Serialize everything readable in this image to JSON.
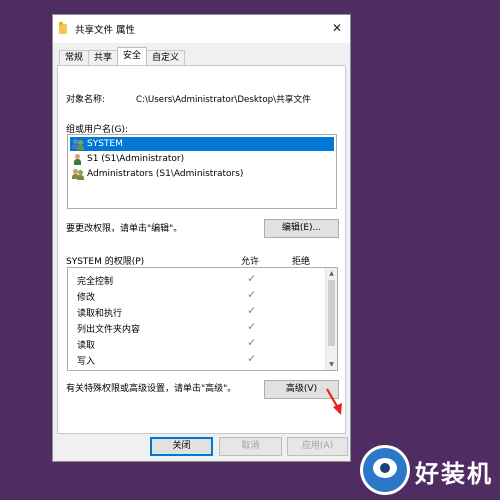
{
  "window": {
    "title": "共享文件 属性"
  },
  "tabs": [
    {
      "label": "常规"
    },
    {
      "label": "共享"
    },
    {
      "label": "安全"
    },
    {
      "label": "自定义"
    }
  ],
  "security": {
    "object_label": "对象名称:",
    "object_value": "C:\\Users\\Administrator\\Desktop\\共享文件",
    "group_label": "组或用户名(G):",
    "users": [
      {
        "name": "SYSTEM"
      },
      {
        "name": "S1 (S1\\Administrator)"
      },
      {
        "name": "Administrators (S1\\Administrators)"
      }
    ],
    "change_text": "要更改权限，请单击\"编辑\"。",
    "edit_button": "编辑(E)...",
    "perm_label": "SYSTEM 的权限(P)",
    "allow_header": "允许",
    "deny_header": "拒绝",
    "permissions": [
      {
        "name": "完全控制",
        "allow": "✓"
      },
      {
        "name": "修改",
        "allow": "✓"
      },
      {
        "name": "读取和执行",
        "allow": "✓"
      },
      {
        "name": "列出文件夹内容",
        "allow": "✓"
      },
      {
        "name": "读取",
        "allow": "✓"
      },
      {
        "name": "写入",
        "allow": "✓"
      }
    ],
    "advanced_text": "有关特殊权限或高级设置，请单击\"高级\"。",
    "advanced_button": "高级(V)"
  },
  "footer": {
    "close_button": "关闭",
    "cancel_button": "取消",
    "apply_button": "应用(A)"
  },
  "watermark": {
    "text": "好装机"
  },
  "colors": {
    "selection": "#0078d7",
    "background": "#4f2d62",
    "arrow": "#e8211a"
  }
}
